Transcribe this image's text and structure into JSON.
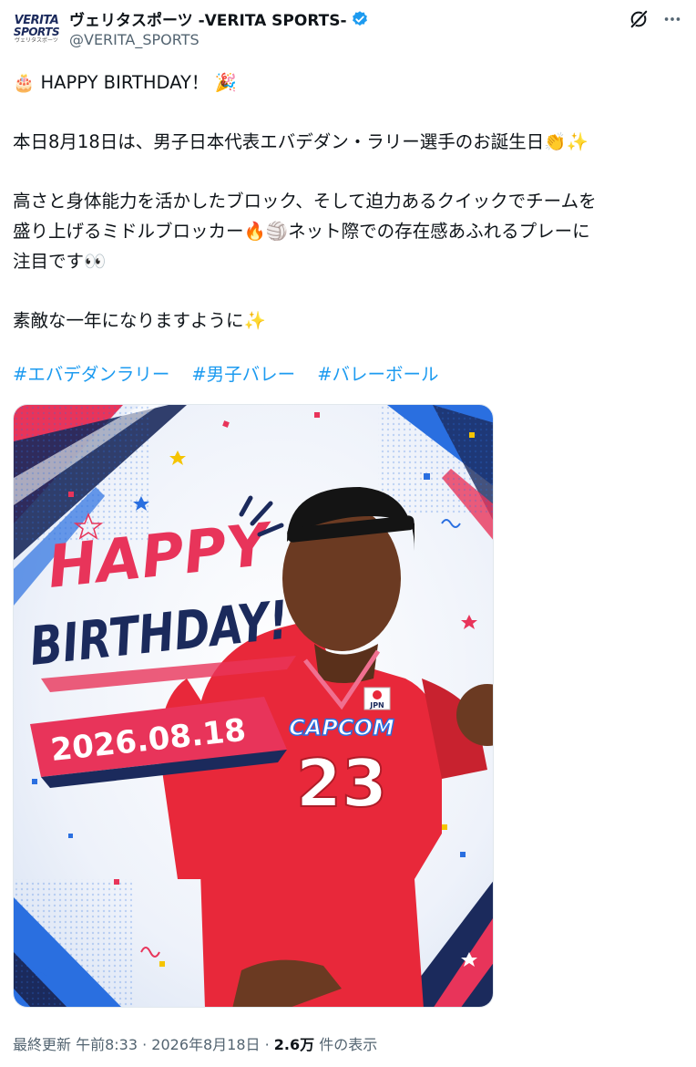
{
  "account": {
    "display_name": "ヴェリタスポーツ -VERITA SPORTS-",
    "handle": "@VERITA_SPORTS",
    "avatar_logo_line1": "VERITA",
    "avatar_logo_line2": "SPORTS",
    "avatar_logo_line3": "ヴェリタスポーツ",
    "verified": true
  },
  "icons": {
    "cake": "cake-emoji",
    "party": "party-popper-emoji",
    "clap": "clap-emoji",
    "sparkles": "sparkles-emoji",
    "fire": "fire-emoji",
    "volleyball": "volleyball-emoji",
    "eyes": "eyes-emoji",
    "grok": "grok-icon",
    "more": "more-icon"
  },
  "post": {
    "line1": "HAPPY BIRTHDAY！",
    "line2": "本日8月18日は、男子日本代表エバデダン・ラリー選手のお誕生日",
    "line3a": "高さと身体能力を活かしたブロック、そして迫力あるクイックでチームを",
    "line3b_pre": "盛り上げるミドルブロッカー",
    "line3b_post": "ネット際での存在感あふれるプレーに",
    "line3c": "注目です",
    "line4": "素敵な一年になりますように",
    "hashtags": [
      "#エバデダンラリー",
      "#男子バレー",
      "#バレーボール"
    ]
  },
  "image": {
    "title_happy": "HAPPY",
    "title_birthday": "BIRTHDAY!",
    "date": "2026.08.18",
    "jersey_sponsor": "CAPCOM",
    "jersey_number": "23",
    "jersey_flag_label": "JPN",
    "colors": {
      "red": "#e8283a",
      "pink": "#e8345a",
      "navy": "#1b2a5c",
      "blue": "#2a6fe0"
    }
  },
  "meta": {
    "prefix": "最終更新 午前8:33 · 2026年8月18日 · ",
    "views": "2.6万",
    "views_suffix": " 件の表示"
  }
}
